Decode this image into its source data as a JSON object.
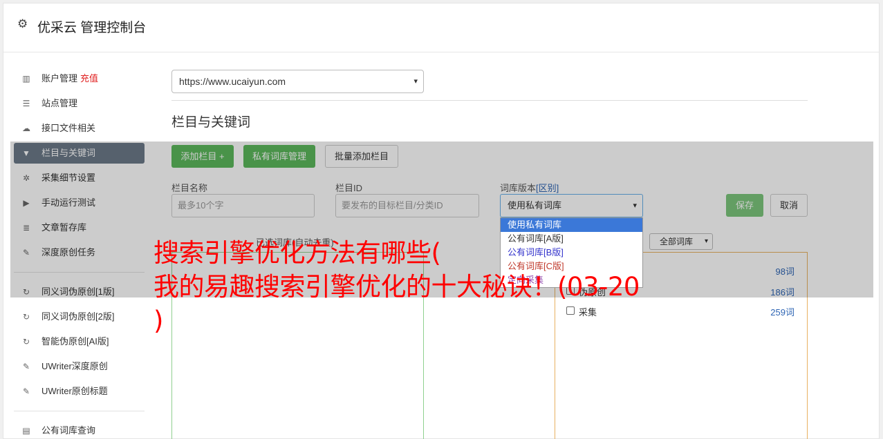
{
  "header": {
    "title": "优采云 管理控制台"
  },
  "sidebar": {
    "items": [
      {
        "label": "账户管理",
        "badge": "充值",
        "icon": "bar-chart-icon"
      },
      {
        "label": "站点管理",
        "icon": "server-icon"
      },
      {
        "label": "接口文件相关",
        "icon": "cloud-upload-icon"
      },
      {
        "label": "栏目与关键词",
        "icon": "filter-icon",
        "active": true
      },
      {
        "label": "采集细节设置",
        "icon": "gears-icon"
      },
      {
        "label": "手动运行测试",
        "icon": "play-circle-icon"
      },
      {
        "label": "文章暂存库",
        "icon": "database-icon"
      },
      {
        "label": "深度原创任务",
        "icon": "edit-icon"
      },
      {
        "label": "同义词伪原创[1版]",
        "icon": "refresh-icon"
      },
      {
        "label": "同义词伪原创[2版]",
        "icon": "refresh-icon"
      },
      {
        "label": "智能伪原创[AI版]",
        "icon": "refresh-icon"
      },
      {
        "label": "UWriter深度原创",
        "icon": "edit-icon"
      },
      {
        "label": "UWriter原创标题",
        "icon": "edit-icon"
      },
      {
        "label": "公有词库查询",
        "icon": "book-icon"
      }
    ]
  },
  "main": {
    "site_select": "https://www.ucaiyun.com",
    "section_title": "栏目与关键词",
    "buttons": {
      "add_column": "添加栏目 +",
      "private_dict": "私有词库管理",
      "batch_add": "批量添加栏目",
      "save": "保存",
      "cancel": "取消"
    },
    "form": {
      "name_label": "栏目名称",
      "name_placeholder": "最多10个字",
      "id_label": "栏目ID",
      "id_placeholder": "要发布的目标栏目/分类ID",
      "dict_label": "词库版本",
      "dict_label_link": "[区别]",
      "dict_selected": "使用私有词库"
    },
    "dict_options": [
      {
        "label": "使用私有词库",
        "color": "#ffffff"
      },
      {
        "label": "公有词库[A版]",
        "color": "#333333"
      },
      {
        "label": "公有词库[B版]",
        "color": "#3333cc"
      },
      {
        "label": "公有词库[C版]",
        "color": "#c0392b"
      },
      {
        "label": "定向采集",
        "color": "#8e44ad"
      }
    ],
    "keywords": {
      "selected_label": "已选词库(自动去重)",
      "filter_value": "全部词库",
      "rows": [
        {
          "name": "",
          "count": "98词"
        },
        {
          "name": "伪原创",
          "count": "186词"
        },
        {
          "name": "采集",
          "count": "259词"
        }
      ]
    }
  },
  "overlay_text": {
    "line1": "搜索引擎优化方法有哪些(",
    "line2": "我的易趣搜索引擎优化的十大秘诀！(03-20",
    "line3": ")"
  }
}
